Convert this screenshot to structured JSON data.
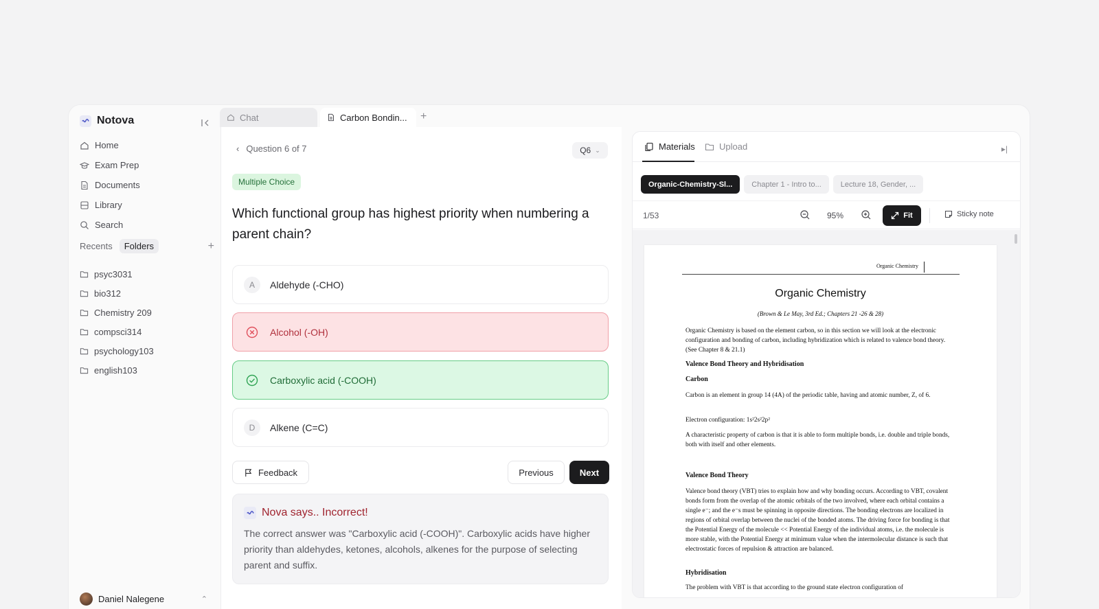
{
  "sidebar": {
    "brand": "Notova",
    "nav": [
      {
        "label": "Home"
      },
      {
        "label": "Exam Prep"
      },
      {
        "label": "Documents"
      },
      {
        "label": "Library"
      },
      {
        "label": "Search"
      }
    ],
    "recents_label": "Recents",
    "folders_label": "Folders",
    "folders": [
      "psyc3031",
      "bio312",
      "Chemistry 209",
      "compsci314",
      "psychology103",
      "english103"
    ],
    "user_name": "Daniel Nalegene"
  },
  "tabs": {
    "chat_label": "Chat",
    "doc_label": "Carbon Bondin...",
    "add_label": "+"
  },
  "quiz": {
    "progress_label": "Question 6 of 7",
    "selector_label": "Q6",
    "type_badge": "Multiple Choice",
    "question": "Which functional group has highest priority when numbering a parent chain?",
    "options": [
      {
        "letter": "A",
        "text": "Aldehyde (-CHO)",
        "state": "default"
      },
      {
        "letter": "B",
        "text": "Alcohol (-OH)",
        "state": "incorrect"
      },
      {
        "letter": "C",
        "text": "Carboxylic acid (-COOH)",
        "state": "correct"
      },
      {
        "letter": "D",
        "text": "Alkene (C=C)",
        "state": "default"
      }
    ],
    "feedback_label": "Feedback",
    "previous_label": "Previous",
    "next_label": "Next",
    "nova_title": "Nova says.. Incorrect!",
    "nova_text": "The correct answer was \"Carboxylic acid (-COOH)\". Carboxylic acids have higher priority than aldehydes, ketones, alcohols, alkenes for the purpose of selecting parent and suffix."
  },
  "materials": {
    "tab_materials": "Materials",
    "tab_upload": "Upload",
    "docs": [
      "Organic-Chemistry-Sl...",
      "Chapter 1 - Intro to...",
      "Lecture 18, Gender, ..."
    ],
    "page_indicator": "1/53",
    "zoom": "95%",
    "fit_label": "Fit",
    "sticky_label": "Sticky note"
  },
  "pdf": {
    "header": "Organic Chemistry",
    "title": "Organic Chemistry",
    "subtitle": "(Brown & Le May, 3rd Ed.; Chapters 21 -26 & 28)",
    "intro": "Organic Chemistry is based on the element carbon, so in this section we will look at the electronic configuration and bonding of carbon, including hybridization which is related to valence bond theory. (See Chapter 8 & 21.1)",
    "h1": "Valence Bond Theory and Hybridisation",
    "h2": "Carbon",
    "carbon_text": "Carbon is an element in group 14 (4A) of the periodic table, having and atomic number, Z, of 6.",
    "econfig": "Electron configuration:      1s²2s²2p²",
    "property_text": "A characteristic property of carbon is that it is able to form multiple bonds, i.e. double and triple bonds, both with itself and other elements.",
    "h3": "Valence Bond Theory",
    "vbt_text": "Valence bond theory (VBT) tries to explain how and why bonding occurs.  According to VBT, covalent bonds form from the overlap of the atomic orbitals of the two involved, where each orbital contains a single e⁻; and the e⁻s must be spinning in opposite directions.  The bonding electrons are localized in regions of orbital overlap between the nuclei of the bonded atoms.  The driving force for bonding is that the Potential Energy of the molecule << Potential Energy of the individual atoms, i.e. the molecule is more stable, with the Potential Energy at minimum value when the intermolecular distance is such that electrostatic forces of repulsion & attraction are balanced.",
    "h4": "Hybridisation",
    "last_line": "The problem with VBT is that according to the ground state electron configuration of"
  }
}
